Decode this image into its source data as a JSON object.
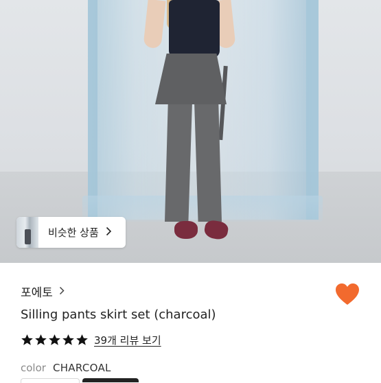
{
  "product_image": {
    "similar_products_label": "비슷한 상품"
  },
  "brand": {
    "name": "포에토"
  },
  "product": {
    "title": "Silling pants skirt set (charcoal)",
    "rating_stars": 5,
    "reviews_label": "39개 리뷰 보기",
    "color_key": "color",
    "color_value": "CHARCOAL"
  },
  "colors": {
    "heart": "#F26A2E",
    "star": "#111111"
  },
  "icons": [
    "chevron-right-icon",
    "heart-icon",
    "star-icon"
  ]
}
